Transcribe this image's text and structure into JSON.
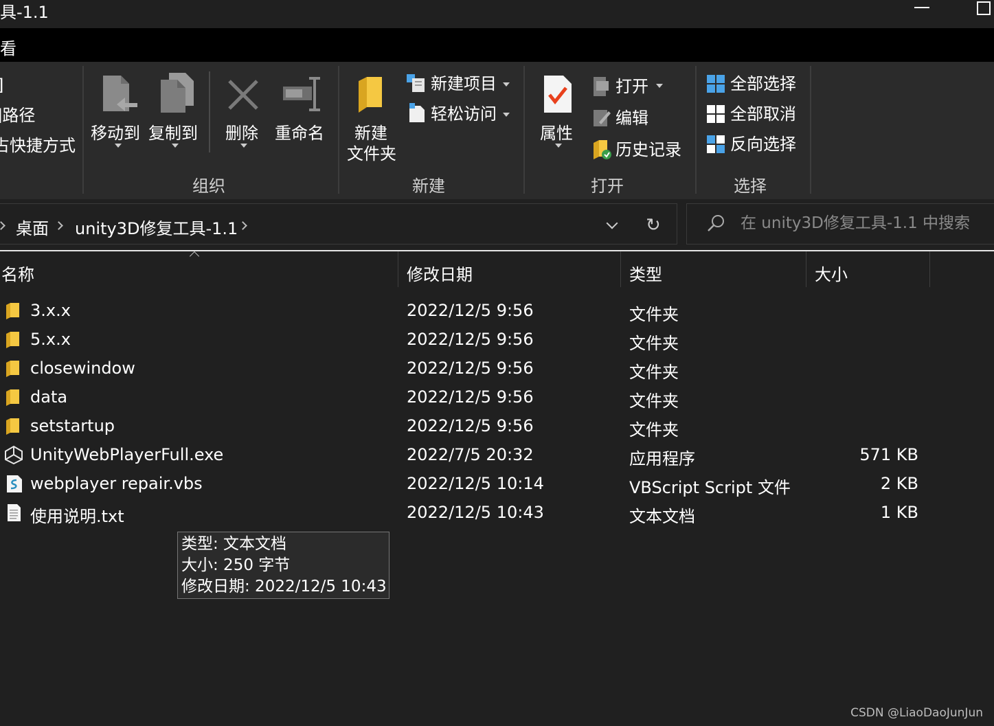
{
  "window": {
    "title": "具-1.1"
  },
  "menubar": {
    "tab": "看"
  },
  "ribbon": {
    "partial_items": [
      "]",
      "]路径",
      "占快捷方式"
    ],
    "organize": {
      "group_label": "组织",
      "move_to": "移动到",
      "copy_to": "复制到",
      "delete": "删除",
      "rename": "重命名"
    },
    "new": {
      "group_label": "新建",
      "new_folder_line1": "新建",
      "new_folder_line2": "文件夹",
      "new_item": "新建项目",
      "easy_access": "轻松访问"
    },
    "open": {
      "group_label": "打开",
      "properties": "属性",
      "open": "打开",
      "edit": "编辑",
      "history": "历史记录"
    },
    "select": {
      "group_label": "选择",
      "select_all": "全部选择",
      "select_none": "全部取消",
      "invert": "反向选择"
    }
  },
  "address": {
    "crumbs": [
      "桌面",
      "unity3D修复工具-1.1"
    ],
    "search_placeholder": "在 unity3D修复工具-1.1 中搜索"
  },
  "columns": {
    "name": "名称",
    "date": "修改日期",
    "type": "类型",
    "size": "大小"
  },
  "files": [
    {
      "icon": "folder-icon",
      "name": "3.x.x",
      "date": "2022/12/5 9:56",
      "type": "文件夹",
      "size": ""
    },
    {
      "icon": "folder-icon",
      "name": "5.x.x",
      "date": "2022/12/5 9:56",
      "type": "文件夹",
      "size": ""
    },
    {
      "icon": "folder-icon",
      "name": "closewindow",
      "date": "2022/12/5 9:56",
      "type": "文件夹",
      "size": ""
    },
    {
      "icon": "folder-icon",
      "name": "data",
      "date": "2022/12/5 9:56",
      "type": "文件夹",
      "size": ""
    },
    {
      "icon": "folder-icon",
      "name": "setstartup",
      "date": "2022/12/5 9:56",
      "type": "文件夹",
      "size": ""
    },
    {
      "icon": "unity-exe-icon",
      "name": "UnityWebPlayerFull.exe",
      "date": "2022/7/5 20:32",
      "type": "应用程序",
      "size": "571 KB"
    },
    {
      "icon": "vbs-script-icon",
      "name": "webplayer repair.vbs",
      "date": "2022/12/5 10:14",
      "type": "VBScript Script 文件",
      "size": "2 KB"
    },
    {
      "icon": "text-file-icon",
      "name": "使用说明.txt",
      "date": "2022/12/5 10:43",
      "type": "文本文档",
      "size": "1 KB"
    }
  ],
  "tooltip": {
    "line1": "类型: 文本文档",
    "line2": "大小: 250 字节",
    "line3": "修改日期: 2022/12/5 10:43"
  },
  "watermark": "CSDN @LiaoDaoJunJun",
  "colors": {
    "background": "#202020",
    "ribbon": "#2b2b2b",
    "menubar": "#000000",
    "folder": "#f5c842",
    "accent_blue": "#4aa3e8"
  }
}
